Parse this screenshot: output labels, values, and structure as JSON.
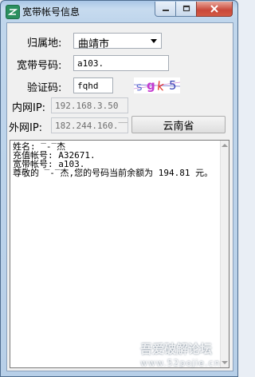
{
  "window": {
    "title": "宽带帐号信息"
  },
  "form": {
    "region_label": "归属地:",
    "region_value": "曲靖市",
    "account_label": "宽带号码:",
    "account_value": "a103.",
    "captcha_label": "验证码:",
    "captcha_value": "fqhd",
    "captcha_image_text": "sgk5",
    "lan_ip_label": "内网IP:",
    "lan_ip_value": "192.168.3.50",
    "wan_ip_label": "外网IP:",
    "wan_ip_value": "182.244.160.‾‾‾",
    "province_button": "云南省"
  },
  "output": {
    "lines": [
      "姓名: ‾-‾杰",
      "充值帐号: A32671.",
      "宽带帐号: a103.",
      "尊敬的 ‾-‾杰,您的号码当前余额为 194.81 元。"
    ]
  },
  "watermark": {
    "line1": "吾爱破解论坛",
    "line2": "www.52pojie.cn"
  },
  "colors": {
    "title_bar": "#c7dbef",
    "close_button": "#c9483a",
    "captcha_s": "#5b6bd1",
    "captcha_g": "#c43ad0",
    "captcha_k": "#e2362a",
    "captcha_5": "#3d47b8"
  }
}
